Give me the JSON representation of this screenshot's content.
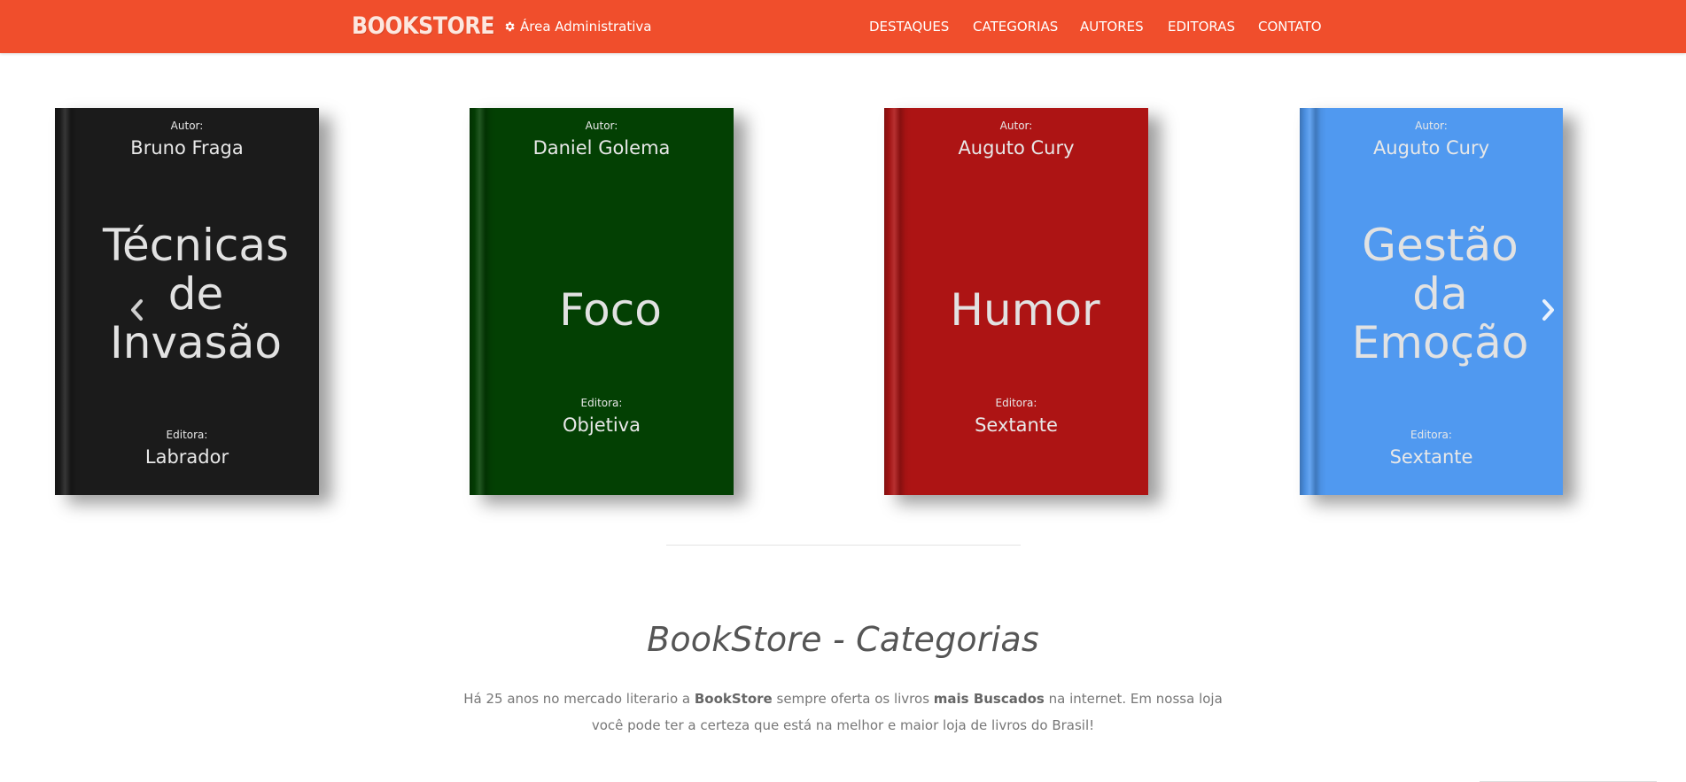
{
  "navbar": {
    "brand": "BOOKSTORE",
    "admin_label": "Área Administrativa",
    "admin_icon": "gear-icon",
    "menu": [
      "DESTAQUES",
      "CATEGORIAS",
      "AUTORES",
      "EDITORAS",
      "CONTATO"
    ],
    "background": "#f04e2c"
  },
  "carousel": {
    "prev_icon": "chevron-left-icon",
    "next_icon": "chevron-right-icon",
    "books": [
      {
        "author_label": "Autor:",
        "author": "Bruno Fraga",
        "title": "Técnicas de Invasão",
        "title_lines": [
          "Técnicas",
          "de",
          "Invasão"
        ],
        "publisher_label": "Editora:",
        "publisher": "Labrador",
        "color": "#1b1b1b"
      },
      {
        "author_label": "Autor:",
        "author": "Daniel Golema",
        "title": "Foco",
        "title_lines": [
          "Foco"
        ],
        "publisher_label": "Editora:",
        "publisher": "Objetiva",
        "color": "#034003"
      },
      {
        "author_label": "Autor:",
        "author": "Auguto Cury",
        "title": "Humor",
        "title_lines": [
          "Humor"
        ],
        "publisher_label": "Editora:",
        "publisher": "Sextante",
        "color": "#ad1414"
      },
      {
        "author_label": "Autor:",
        "author": "Auguto Cury",
        "title": "Gestão da Emoção",
        "title_lines": [
          "Gestão",
          "da",
          "Emoção"
        ],
        "publisher_label": "Editora:",
        "publisher": "Sextante",
        "color": "#5099f0"
      }
    ]
  },
  "section": {
    "title": "BookStore - Categorias",
    "text_parts": [
      "Há 25 anos no mercado literario a ",
      "BookStore",
      " sempre oferta os livros ",
      "mais Buscados",
      " na internet. Em nossa loja você pode ter a certeza que está na melhor e maior loja de livros do Brasil!"
    ]
  }
}
